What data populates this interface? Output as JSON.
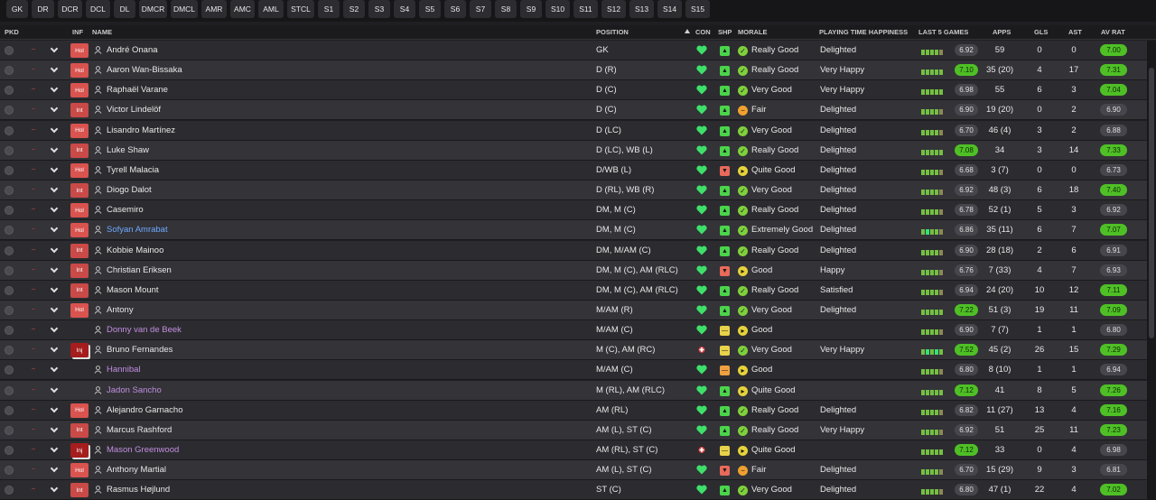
{
  "filters": [
    "GK",
    "DR",
    "DCR",
    "DCL",
    "DL",
    "DMCR",
    "DMCL",
    "AMR",
    "AMC",
    "AML",
    "STCL",
    "S1",
    "S2",
    "S3",
    "S4",
    "S5",
    "S6",
    "S7",
    "S8",
    "S9",
    "S10",
    "S11",
    "S12",
    "S13",
    "S14",
    "S15"
  ],
  "columns": {
    "pkd": "PKD",
    "inf": "INF",
    "name": "NAME",
    "position": "POSITION",
    "con": "CON",
    "shp": "SHP",
    "morale": "MORALE",
    "pth": "PLAYING TIME HAPPINESS",
    "last5": "LAST 5 GAMES",
    "apps": "APPS",
    "gls": "GLS",
    "ast": "AST",
    "avrat": "AV RAT"
  },
  "sort": {
    "column": "position",
    "direction": "ascending"
  },
  "colors": {
    "good": "#4fbf26",
    "very_good": "#2fe05a",
    "fair": "#f0a030",
    "loss": "#c94a47",
    "injury": "#a51d1d",
    "loan_name": "#c28ee0",
    "highlight_name": "#6fa9ff"
  },
  "players": [
    {
      "inf": "Hol",
      "name": "André Onana",
      "position": "GK",
      "con": "heart",
      "shp": "green",
      "morale_icon": "very-good",
      "morale": "Really Good",
      "pth": "Delighted",
      "form": [
        "g",
        "g",
        "g",
        "g",
        "l"
      ],
      "last": "6.92",
      "last_good": false,
      "apps": "59",
      "gls": "0",
      "ast": "0",
      "avrat": "7.00",
      "av_good": true
    },
    {
      "inf": "Hol",
      "name": "Aaron Wan-Bissaka",
      "position": "D (R)",
      "con": "heart",
      "shp": "green",
      "morale_icon": "very-good",
      "morale": "Really Good",
      "pth": "Very Happy",
      "form": [
        "g",
        "g",
        "g",
        "g",
        "g"
      ],
      "last": "7.10",
      "last_good": true,
      "apps": "35 (20)",
      "gls": "4",
      "ast": "17",
      "avrat": "7.31",
      "av_good": true
    },
    {
      "inf": "Hol",
      "name": "Raphaël Varane",
      "position": "D (C)",
      "con": "heart",
      "shp": "green",
      "morale_icon": "very-good",
      "morale": "Very Good",
      "pth": "Very Happy",
      "form": [
        "g",
        "g",
        "g",
        "g",
        "g"
      ],
      "last": "6.98",
      "last_good": false,
      "apps": "55",
      "gls": "6",
      "ast": "3",
      "avrat": "7.04",
      "av_good": true
    },
    {
      "inf": "Int",
      "name": "Victor Lindelöf",
      "position": "D (C)",
      "con": "heart",
      "shp": "green",
      "morale_icon": "fair",
      "morale": "Fair",
      "pth": "Delighted",
      "form": [
        "g",
        "g",
        "g",
        "g",
        "l"
      ],
      "last": "6.90",
      "last_good": false,
      "apps": "19 (20)",
      "gls": "0",
      "ast": "2",
      "avrat": "6.90",
      "av_good": false
    },
    {
      "inf": "Hol",
      "name": "Lisandro Martínez",
      "position": "D (LC)",
      "con": "heart",
      "shp": "green",
      "morale_icon": "very-good",
      "morale": "Very Good",
      "pth": "Delighted",
      "form": [
        "g",
        "g",
        "g",
        "g",
        "l"
      ],
      "last": "6.70",
      "last_good": false,
      "apps": "46 (4)",
      "gls": "3",
      "ast": "2",
      "avrat": "6.88",
      "av_good": false
    },
    {
      "inf": "Int",
      "name": "Luke Shaw",
      "position": "D (LC), WB (L)",
      "con": "heart",
      "shp": "green",
      "morale_icon": "very-good",
      "morale": "Really Good",
      "pth": "Delighted",
      "form": [
        "g",
        "g",
        "g",
        "g",
        "g"
      ],
      "last": "7.08",
      "last_good": true,
      "apps": "34",
      "gls": "3",
      "ast": "14",
      "avrat": "7.33",
      "av_good": true
    },
    {
      "inf": "Hol",
      "name": "Tyrell Malacia",
      "position": "D/WB (L)",
      "con": "heart",
      "shp": "red",
      "morale_icon": "good",
      "morale": "Quite Good",
      "pth": "Delighted",
      "form": [
        "g",
        "g",
        "g",
        "g",
        "l"
      ],
      "last": "6.68",
      "last_good": false,
      "apps": "3 (7)",
      "gls": "0",
      "ast": "0",
      "avrat": "6.73",
      "av_good": false
    },
    {
      "inf": "Int",
      "name": "Diogo Dalot",
      "position": "D (RL), WB (R)",
      "con": "heart",
      "shp": "green",
      "morale_icon": "very-good",
      "morale": "Very Good",
      "pth": "Delighted",
      "form": [
        "g",
        "g",
        "g",
        "g",
        "l"
      ],
      "last": "6.92",
      "last_good": false,
      "apps": "48 (3)",
      "gls": "6",
      "ast": "18",
      "avrat": "7.40",
      "av_good": true
    },
    {
      "inf": "Hol",
      "name": "Casemiro",
      "position": "DM, M (C)",
      "con": "heart",
      "shp": "green",
      "morale_icon": "very-good",
      "morale": "Really Good",
      "pth": "Delighted",
      "form": [
        "g",
        "g",
        "g",
        "g",
        "l"
      ],
      "last": "6.78",
      "last_good": false,
      "apps": "52 (1)",
      "gls": "5",
      "ast": "3",
      "avrat": "6.92",
      "av_good": false
    },
    {
      "inf": "Hol",
      "name": "Sofyan Amrabat",
      "position": "DM, M (C)",
      "con": "heart",
      "shp": "green",
      "morale_icon": "very-good",
      "morale": "Extremely Good",
      "pth": "Delighted",
      "form": [
        "g",
        "v",
        "g",
        "g",
        "l"
      ],
      "last": "6.86",
      "last_good": false,
      "apps": "35 (11)",
      "gls": "6",
      "ast": "7",
      "avrat": "7.07",
      "av_good": true,
      "name_style": "blue"
    },
    {
      "inf": "Int",
      "name": "Kobbie Mainoo",
      "position": "DM, M/AM (C)",
      "con": "heart",
      "shp": "green",
      "morale_icon": "very-good",
      "morale": "Really Good",
      "pth": "Delighted",
      "form": [
        "g",
        "g",
        "g",
        "g",
        "l"
      ],
      "last": "6.90",
      "last_good": false,
      "apps": "28 (18)",
      "gls": "2",
      "ast": "6",
      "avrat": "6.91",
      "av_good": false
    },
    {
      "inf": "Int",
      "name": "Christian Eriksen",
      "position": "DM, M (C), AM (RLC)",
      "con": "heart",
      "shp": "red",
      "morale_icon": "good",
      "morale": "Good",
      "pth": "Happy",
      "form": [
        "g",
        "g",
        "g",
        "g",
        "l"
      ],
      "last": "6.76",
      "last_good": false,
      "apps": "7 (33)",
      "gls": "4",
      "ast": "7",
      "avrat": "6.93",
      "av_good": false
    },
    {
      "inf": "Int",
      "name": "Mason Mount",
      "position": "DM, M (C), AM (RLC)",
      "con": "heart",
      "shp": "green",
      "morale_icon": "very-good",
      "morale": "Really Good",
      "pth": "Satisfied",
      "form": [
        "g",
        "g",
        "g",
        "g",
        "l"
      ],
      "last": "6.94",
      "last_good": false,
      "apps": "24 (20)",
      "gls": "10",
      "ast": "12",
      "avrat": "7.11",
      "av_good": true
    },
    {
      "inf": "Hol",
      "name": "Antony",
      "position": "M/AM (R)",
      "con": "heart",
      "shp": "green",
      "morale_icon": "very-good",
      "morale": "Very Good",
      "pth": "Delighted",
      "form": [
        "g",
        "g",
        "g",
        "g",
        "g"
      ],
      "last": "7.22",
      "last_good": true,
      "apps": "51 (3)",
      "gls": "19",
      "ast": "11",
      "avrat": "7.09",
      "av_good": true
    },
    {
      "inf": "",
      "name": "Donny van de Beek",
      "position": "M/AM (C)",
      "con": "heart",
      "shp": "yellow",
      "morale_icon": "good",
      "morale": "Good",
      "pth": "",
      "form": [
        "g",
        "g",
        "g",
        "g",
        "l"
      ],
      "last": "6.90",
      "last_good": false,
      "apps": "7 (7)",
      "gls": "1",
      "ast": "1",
      "avrat": "6.80",
      "av_good": false,
      "name_style": "loan"
    },
    {
      "inf": "Inj",
      "name": "Bruno Fernandes",
      "position": "M (C), AM (RC)",
      "con": "injury",
      "shp": "yellow",
      "morale_icon": "very-good",
      "morale": "Very Good",
      "pth": "Very Happy",
      "form": [
        "g",
        "v",
        "g",
        "v",
        "g"
      ],
      "last": "7.52",
      "last_good": true,
      "apps": "45 (2)",
      "gls": "26",
      "ast": "15",
      "avrat": "7.29",
      "av_good": true
    },
    {
      "inf": "",
      "name": "Hannibal",
      "position": "M/AM (C)",
      "con": "heart",
      "shp": "orange",
      "morale_icon": "good",
      "morale": "Good",
      "pth": "",
      "form": [
        "g",
        "g",
        "g",
        "g",
        "l"
      ],
      "last": "6.80",
      "last_good": false,
      "apps": "8 (10)",
      "gls": "1",
      "ast": "1",
      "avrat": "6.94",
      "av_good": false,
      "name_style": "loan"
    },
    {
      "inf": "",
      "name": "Jadon Sancho",
      "position": "M (RL), AM (RLC)",
      "con": "heart",
      "shp": "green",
      "morale_icon": "good",
      "morale": "Quite Good",
      "pth": "",
      "form": [
        "g",
        "g",
        "g",
        "g",
        "g"
      ],
      "last": "7.12",
      "last_good": true,
      "apps": "41",
      "gls": "8",
      "ast": "5",
      "avrat": "7.26",
      "av_good": true,
      "name_style": "loan"
    },
    {
      "inf": "Hol",
      "name": "Alejandro Garnacho",
      "position": "AM (RL)",
      "con": "heart",
      "shp": "green",
      "morale_icon": "very-good",
      "morale": "Really Good",
      "pth": "Delighted",
      "form": [
        "g",
        "g",
        "g",
        "g",
        "l"
      ],
      "last": "6.82",
      "last_good": false,
      "apps": "11 (27)",
      "gls": "13",
      "ast": "4",
      "avrat": "7.16",
      "av_good": true
    },
    {
      "inf": "Int",
      "name": "Marcus Rashford",
      "position": "AM (L), ST (C)",
      "con": "heart",
      "shp": "green",
      "morale_icon": "very-good",
      "morale": "Really Good",
      "pth": "Very Happy",
      "form": [
        "g",
        "g",
        "g",
        "g",
        "l"
      ],
      "last": "6.92",
      "last_good": false,
      "apps": "51",
      "gls": "25",
      "ast": "11",
      "avrat": "7.23",
      "av_good": true
    },
    {
      "inf": "Inj",
      "name": "Mason Greenwood",
      "position": "AM (RL), ST (C)",
      "con": "injury",
      "shp": "yellow",
      "morale_icon": "good",
      "morale": "Quite Good",
      "pth": "",
      "form": [
        "g",
        "g",
        "g",
        "g",
        "g"
      ],
      "last": "7.12",
      "last_good": true,
      "apps": "33",
      "gls": "0",
      "ast": "4",
      "avrat": "6.98",
      "av_good": false,
      "name_style": "loan"
    },
    {
      "inf": "Hol",
      "name": "Anthony Martial",
      "position": "AM (L), ST (C)",
      "con": "heart",
      "shp": "red",
      "morale_icon": "fair",
      "morale": "Fair",
      "pth": "Delighted",
      "form": [
        "g",
        "g",
        "g",
        "g",
        "l"
      ],
      "last": "6.70",
      "last_good": false,
      "apps": "15 (29)",
      "gls": "9",
      "ast": "3",
      "avrat": "6.81",
      "av_good": false
    },
    {
      "inf": "Int",
      "name": "Rasmus Højlund",
      "position": "ST (C)",
      "con": "heart",
      "shp": "green",
      "morale_icon": "very-good",
      "morale": "Very Good",
      "pth": "Delighted",
      "form": [
        "g",
        "g",
        "g",
        "g",
        "l"
      ],
      "last": "6.80",
      "last_good": false,
      "apps": "47 (1)",
      "gls": "22",
      "ast": "4",
      "avrat": "7.02",
      "av_good": true
    }
  ]
}
